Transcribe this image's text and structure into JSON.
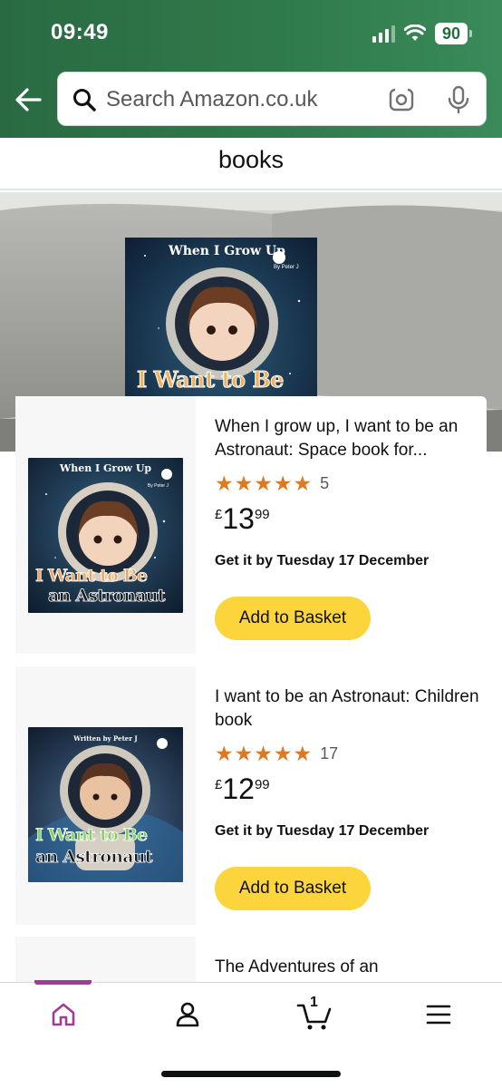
{
  "status_bar": {
    "time": "09:49",
    "battery": "90"
  },
  "search": {
    "placeholder": "Search Amazon.co.uk"
  },
  "header_snippet": {
    "title": "books"
  },
  "hero": {
    "book_top_title": "When I Grow Up",
    "book_author": "By Peter J",
    "book_subtitle": "I Want to Be"
  },
  "products": [
    {
      "title": "When I grow up, I want to be an Astronaut: Space book for...",
      "rating": 5,
      "review_count": "5",
      "price_symbol": "£",
      "price_whole": "13",
      "price_fraction": "99",
      "delivery": "Get it by Tuesday 17 December",
      "button_label": "Add to Basket",
      "cover": {
        "top": "When I Grow Up",
        "author": "By Peter J",
        "line1": "I Want to Be",
        "line2": "an Astronaut"
      }
    },
    {
      "title": "I want to be an Astronaut: Children book",
      "rating": 5,
      "review_count": "17",
      "price_symbol": "£",
      "price_whole": "12",
      "price_fraction": "99",
      "delivery": "Get it by Tuesday 17 December",
      "button_label": "Add to Basket",
      "cover": {
        "top": "Written by Peter J",
        "line1": "I Want to Be",
        "line2": "an Astronaut"
      }
    },
    {
      "title": "The Adventures of an"
    }
  ],
  "bottom_nav": {
    "cart_count": "1",
    "items": [
      "home-icon",
      "account-icon",
      "cart-icon",
      "menu-icon"
    ],
    "active_color": "#a03c95"
  },
  "colors": {
    "header_green": "#2f7a4a",
    "button_yellow": "#fcd43c",
    "star_orange": "#de7921"
  }
}
